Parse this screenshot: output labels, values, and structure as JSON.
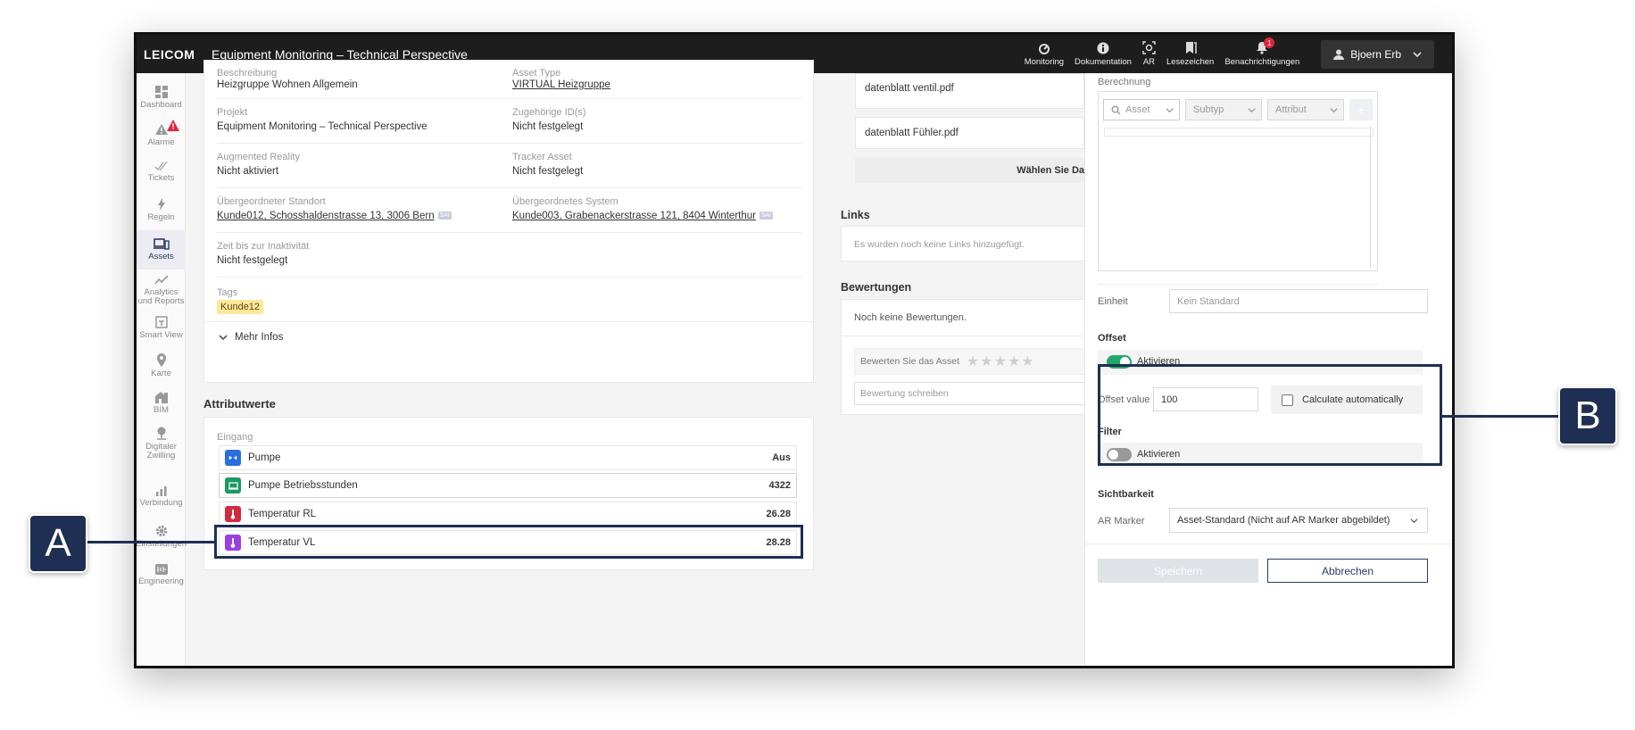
{
  "app": {
    "logo": "LEICOM",
    "title": "Equipment Monitoring – Technical Perspective"
  },
  "toolbar": {
    "items": [
      {
        "label": "Monitoring",
        "icon": "monitoring-icon"
      },
      {
        "label": "Dokumentation",
        "icon": "info-icon"
      },
      {
        "label": "AR",
        "icon": "ar-icon"
      },
      {
        "label": "Lesezeichen",
        "icon": "bookmark-icon"
      },
      {
        "label": "Benachrichtigungen",
        "icon": "bell-icon",
        "badge": "1"
      }
    ],
    "user": "Bjoern Erb"
  },
  "sidebar": {
    "items": [
      {
        "label": "Dashboard"
      },
      {
        "label": "Alarme"
      },
      {
        "label": "Tickets"
      },
      {
        "label": "Regeln"
      },
      {
        "label": "Assets"
      },
      {
        "label": "Analytics und Reports"
      },
      {
        "label": "Smart View"
      },
      {
        "label": "Karte"
      },
      {
        "label": "BIM"
      },
      {
        "label": "Digitaler Zwilling"
      },
      {
        "label": "Verbindung"
      },
      {
        "label": "Einstellungen"
      },
      {
        "label": "Engineering"
      }
    ]
  },
  "details": {
    "top_left_label": "Beschreibung",
    "top_left_value": "Heizgruppe Wohnen Allgemein",
    "top_right_label": "Asset Type",
    "top_right_value": "VIRTUAL Heizgruppe",
    "projekt_label": "Projekt",
    "projekt_value": "Equipment Monitoring – Technical Perspective",
    "ids_label": "Zugehörige ID(s)",
    "ids_value": "Nicht festgelegt",
    "ar_label": "Augmented Reality",
    "ar_value": "Nicht aktiviert",
    "tracker_label": "Tracker Asset",
    "tracker_value": "Nicht festgelegt",
    "standort_label": "Übergeordneter Standort",
    "standort_value": "Kunde012, Schosshaldenstrasse 13, 3006 Bern",
    "standort_badge": "SAI",
    "system_label": "Übergeordnetes System",
    "system_value": "Kunde003, Grabenackerstrasse 121, 8404 Winterthur",
    "system_badge": "SAI",
    "inaktiv_label": "Zeit bis zur Inaktivität",
    "inaktiv_value": "Nicht festgelegt",
    "tags_label": "Tags",
    "tag": "Kunde12",
    "more": "Mehr Infos"
  },
  "attributes": {
    "title": "Attributwerte",
    "group": "Eingang",
    "rows": [
      {
        "name": "Pumpe",
        "value": "Aus",
        "color": "#2a6de0"
      },
      {
        "name": "Pumpe Betriebsstunden",
        "value": "4322",
        "color": "#1b9a63"
      },
      {
        "name": "Temperatur RL",
        "value": "26.28",
        "color": "#d12b3f"
      },
      {
        "name": "Temperatur VL",
        "value": "28.28",
        "color": "#9b3fe0"
      }
    ]
  },
  "docs": {
    "file1": "datenblatt ventil.pdf",
    "file2": "datenblatt Fühler.pdf",
    "choose": "Wählen Sie Da"
  },
  "links": {
    "title": "Links",
    "empty": "Es wurden noch keine Links hinzugefügt."
  },
  "ratings": {
    "title": "Bewertungen",
    "empty": "Noch keine Bewertungen.",
    "rate": "Bewerten Sie das Asset",
    "write_placeholder": "Bewertung schreiben"
  },
  "panel": {
    "berechnung": "Berechnung",
    "asset_placeholder": "Asset",
    "subtyp_placeholder": "Subtyp",
    "attribut_placeholder": "Attribut",
    "add": "+",
    "einheit_label": "Einheit",
    "einheit_placeholder": "Kein Standard",
    "offset_title": "Offset",
    "offset_toggle": "Aktivieren",
    "offset_value_label": "Offset value",
    "offset_value": "100",
    "calc_auto": "Calculate automatically",
    "filter_title": "Filter",
    "filter_toggle": "Aktivieren",
    "sichtbarkeit_title": "Sichtbarkeit",
    "ar_marker_label": "AR Marker",
    "ar_marker_value": "Asset-Standard (Nicht auf AR Marker abgebildet)",
    "save": "Speichern",
    "cancel": "Abbrechen"
  },
  "callouts": {
    "a": "A",
    "b": "B"
  },
  "colors": {
    "navy": "#1f2f53",
    "accent_green": "#1faa6a",
    "topbar": "#1d1d1d"
  }
}
